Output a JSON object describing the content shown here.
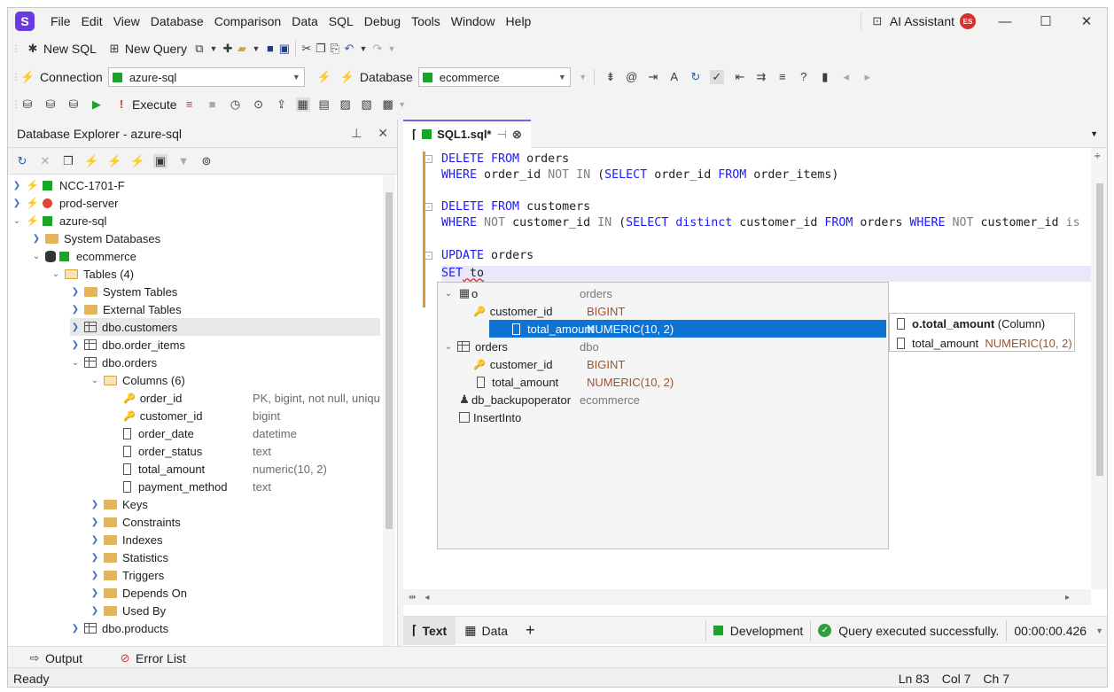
{
  "menu": {
    "logo": "S",
    "items": [
      "File",
      "Edit",
      "View",
      "Database",
      "Comparison",
      "Data",
      "SQL",
      "Debug",
      "Tools",
      "Window",
      "Help"
    ],
    "ai_assistant": "AI Assistant",
    "avatar_initials": "ES"
  },
  "toolbar1": {
    "new_sql": "New SQL",
    "new_query": "New Query"
  },
  "toolbar2": {
    "connection_label": "Connection",
    "connection_value": "azure-sql",
    "database_label": "Database",
    "database_value": "ecommerce"
  },
  "toolbar3": {
    "execute_label": "Execute"
  },
  "explorer": {
    "title": "Database Explorer - azure-sql",
    "nodes": [
      {
        "label": "NCC-1701-F"
      },
      {
        "label": "prod-server"
      },
      {
        "label": "azure-sql"
      },
      {
        "label": "System Databases"
      },
      {
        "label": "ecommerce"
      },
      {
        "label": "Tables (4)"
      },
      {
        "label": "System Tables"
      },
      {
        "label": "External Tables"
      },
      {
        "label": "dbo.customers"
      },
      {
        "label": "dbo.order_items"
      },
      {
        "label": "dbo.orders"
      },
      {
        "label": "Columns (6)"
      },
      {
        "label": "order_id",
        "desc": "PK, bigint, not null, unique"
      },
      {
        "label": "customer_id",
        "desc": "bigint"
      },
      {
        "label": "order_date",
        "desc": "datetime"
      },
      {
        "label": "order_status",
        "desc": "text"
      },
      {
        "label": "total_amount",
        "desc": "numeric(10, 2)"
      },
      {
        "label": "payment_method",
        "desc": "text"
      },
      {
        "label": "Keys"
      },
      {
        "label": "Constraints"
      },
      {
        "label": "Indexes"
      },
      {
        "label": "Statistics"
      },
      {
        "label": "Triggers"
      },
      {
        "label": "Depends On"
      },
      {
        "label": "Used By"
      },
      {
        "label": "dbo.products"
      }
    ]
  },
  "bottom_tabs": {
    "output": "Output",
    "error_list": "Error List"
  },
  "status": {
    "ready": "Ready",
    "ln": "Ln 83",
    "col": "Col 7",
    "ch": "Ch 7"
  },
  "editor": {
    "tab_label": "SQL1.sql*",
    "code": {
      "l1a": "DELETE FROM",
      "l1b": " orders",
      "l2a": "WHERE",
      "l2b": " order_id ",
      "l2c": "NOT IN",
      "l2d": " (",
      "l2e": "SELECT",
      "l2f": " order_id ",
      "l2g": "FROM",
      "l2h": " order_items",
      ")": ")",
      "l4a": "DELETE FROM",
      "l4b": " customers",
      "l5a": "WHERE",
      "l5b": " NOT",
      "l5c": " customer_id ",
      "l5d": "IN",
      "l5e": " (",
      "l5f": "SELECT distinct",
      "l5g": " customer_id ",
      "l5h": "FROM",
      "l5i": " orders ",
      "l5j": "WHERE",
      "l5k": " NOT",
      "l5l": " customer_id ",
      "l5m": "is",
      "l7a": "UPDATE",
      "l7b": " orders",
      "l8a": "SET",
      "l8b": " to"
    },
    "autocomplete": [
      {
        "label": "o",
        "schema": "orders"
      },
      {
        "label": "customer_id",
        "type": "BIGINT"
      },
      {
        "label": "total_amount",
        "type": "NUMERIC(10, 2)"
      },
      {
        "label": "orders",
        "schema": "dbo"
      },
      {
        "label": "customer_id",
        "type": "BIGINT"
      },
      {
        "label": "total_amount",
        "type": "NUMERIC(10, 2)"
      },
      {
        "label": "db_backupoperator",
        "schema": "ecommerce"
      },
      {
        "label": "InsertInto"
      }
    ],
    "tooltip": {
      "name": "o.total_amount",
      "kind": "(Column)",
      "col": "total_amount",
      "type": "NUMERIC(10, 2)"
    }
  },
  "result_bar": {
    "text_tab": "Text",
    "data_tab": "Data",
    "plus": "+",
    "env": "Development",
    "message": "Query executed successfully.",
    "elapsed": "00:00:00.426"
  }
}
